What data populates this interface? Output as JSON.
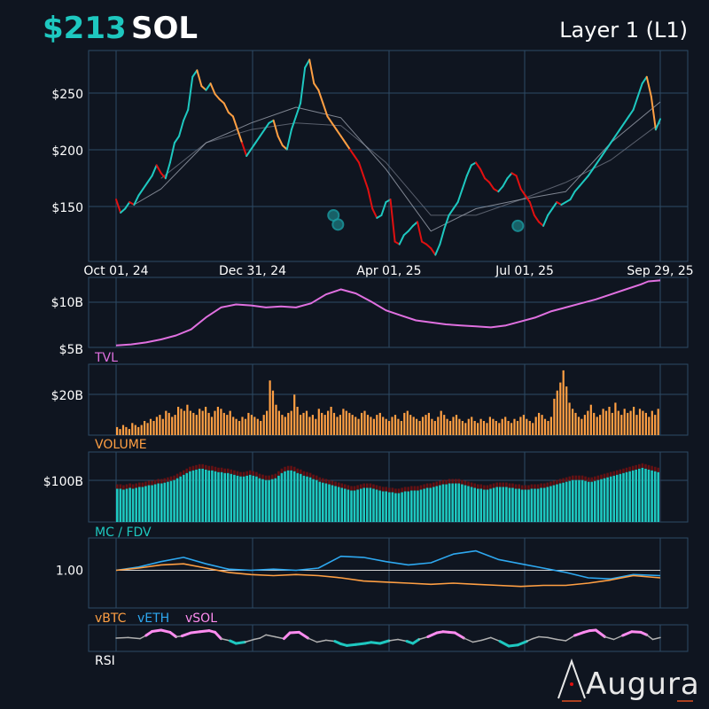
{
  "header": {
    "price": "$213",
    "symbol": "SOL",
    "category": "Layer 1 (L1)"
  },
  "brand": {
    "name": "Augura"
  },
  "colors": {
    "up": "#1ec8c0",
    "mid": "#ff9f43",
    "down": "#e01010",
    "tvl": "#e070e0",
    "volume": "#ff9f43",
    "mc": "#1ec8c0",
    "vbtc": "#ff9f43",
    "veth": "#2ea8f0",
    "vsol": "#ff8cf0",
    "grid": "#2d4a66"
  },
  "chart_data": [
    {
      "id": "price",
      "type": "line",
      "x_ticks": [
        "Oct 01, 24",
        "Dec 31, 24",
        "Apr 01, 25",
        "Jul 01, 25",
        "Sep 29, 25"
      ],
      "y_ticks": [
        "$250",
        "$200",
        "$150"
      ],
      "ylim": [
        105,
        265
      ],
      "series": [
        {
          "role": "price",
          "x": [
            0,
            3,
            6,
            9,
            12,
            15,
            18,
            21,
            24,
            27,
            30,
            33,
            36,
            39,
            42,
            45,
            48,
            51,
            54,
            57,
            60,
            63,
            66,
            69,
            72,
            75,
            78,
            81,
            84,
            87,
            90,
            93,
            96,
            99,
            102,
            105,
            108,
            111,
            114,
            117,
            120,
            123,
            126,
            129,
            132,
            135,
            138,
            141,
            144,
            147,
            150,
            153,
            156,
            159,
            162,
            165,
            168,
            171,
            174,
            177,
            180,
            183,
            186,
            189,
            192,
            195,
            198,
            201,
            204,
            207,
            210,
            213,
            216,
            219,
            222,
            225,
            228,
            231,
            234,
            237,
            240,
            243,
            246,
            249,
            252,
            255,
            258,
            261,
            264,
            267,
            270,
            273,
            276,
            279,
            282,
            285,
            288,
            291,
            294,
            297,
            300,
            303,
            306,
            309,
            312,
            315,
            318,
            321,
            324,
            327,
            330,
            333,
            336,
            339,
            342,
            345,
            348,
            351,
            354,
            357,
            360,
            363
          ],
          "values": [
            152,
            142,
            145,
            150,
            148,
            155,
            160,
            165,
            170,
            178,
            172,
            168,
            180,
            195,
            200,
            212,
            220,
            245,
            250,
            238,
            235,
            240,
            232,
            228,
            225,
            218,
            215,
            205,
            195,
            185,
            190,
            195,
            200,
            205,
            210,
            212,
            200,
            193,
            190,
            205,
            215,
            225,
            252,
            258,
            240,
            235,
            225,
            215,
            210,
            205,
            200,
            195,
            190,
            185,
            180,
            170,
            160,
            145,
            138,
            140,
            150,
            152,
            120,
            118,
            125,
            128,
            132,
            135,
            120,
            118,
            115,
            110,
            118,
            130,
            140,
            145,
            150,
            160,
            170,
            178,
            180,
            175,
            168,
            165,
            160,
            158,
            162,
            168,
            172,
            170,
            160,
            155,
            150,
            140,
            135,
            132,
            140,
            145,
            150,
            148,
            150,
            152,
            158,
            162,
            166,
            170,
            175,
            180,
            185,
            190,
            195,
            200,
            205,
            210,
            215,
            220,
            230,
            240,
            245,
            230,
            205,
            213
          ]
        },
        {
          "role": "ma_short",
          "x": [
            12,
            30,
            60,
            90,
            120,
            150,
            180,
            210,
            240,
            270,
            300,
            330,
            363
          ],
          "values": [
            148,
            160,
            195,
            210,
            222,
            214,
            175,
            128,
            145,
            152,
            158,
            195,
            226
          ]
        },
        {
          "role": "ma_long",
          "x": [
            30,
            60,
            90,
            120,
            150,
            180,
            210,
            240,
            270,
            300,
            330,
            363
          ],
          "values": [
            168,
            195,
            205,
            210,
            208,
            180,
            140,
            140,
            152,
            165,
            182,
            210
          ]
        }
      ],
      "markers": [
        {
          "x": 145,
          "y": 140
        },
        {
          "x": 148,
          "y": 133
        },
        {
          "x": 268,
          "y": 132
        }
      ]
    },
    {
      "id": "tvl",
      "type": "line",
      "label": "TVL",
      "y_ticks": [
        "$10B",
        "$5B"
      ],
      "ylim": [
        5,
        12
      ],
      "series": [
        {
          "name": "TVL",
          "x": [
            0,
            10,
            20,
            30,
            40,
            50,
            60,
            70,
            80,
            90,
            100,
            110,
            120,
            130,
            140,
            150,
            160,
            170,
            180,
            190,
            200,
            210,
            220,
            230,
            240,
            250,
            260,
            270,
            280,
            290,
            300,
            310,
            320,
            330,
            340,
            350,
            355,
            363
          ],
          "values": [
            5.2,
            5.3,
            5.5,
            5.8,
            6.2,
            6.8,
            8.0,
            9.0,
            9.3,
            9.2,
            9.0,
            9.1,
            9.0,
            9.4,
            10.3,
            10.8,
            10.4,
            9.6,
            8.7,
            8.2,
            7.7,
            7.5,
            7.3,
            7.2,
            7.1,
            7.0,
            7.2,
            7.6,
            8.0,
            8.6,
            9.0,
            9.4,
            9.8,
            10.3,
            10.8,
            11.3,
            11.6,
            11.7
          ]
        }
      ]
    },
    {
      "id": "volume",
      "type": "bar",
      "label": "VOLUME",
      "y_ticks": [
        "$20B"
      ],
      "ylim": [
        0,
        35
      ],
      "series": [
        {
          "name": "VOLUME",
          "values": [
            4,
            3,
            5,
            4,
            3,
            6,
            5,
            4,
            5,
            7,
            6,
            8,
            7,
            9,
            10,
            8,
            12,
            11,
            9,
            10,
            14,
            13,
            12,
            15,
            12,
            11,
            10,
            13,
            12,
            14,
            11,
            9,
            12,
            14,
            13,
            11,
            10,
            12,
            9,
            8,
            7,
            9,
            8,
            11,
            10,
            9,
            8,
            7,
            10,
            12,
            27,
            22,
            15,
            12,
            10,
            9,
            11,
            12,
            20,
            14,
            10,
            11,
            12,
            9,
            10,
            8,
            13,
            11,
            10,
            12,
            14,
            11,
            9,
            10,
            13,
            12,
            11,
            10,
            9,
            8,
            11,
            12,
            10,
            9,
            8,
            10,
            11,
            9,
            8,
            7,
            9,
            10,
            8,
            7,
            11,
            12,
            10,
            9,
            8,
            7,
            9,
            10,
            11,
            8,
            7,
            9,
            12,
            10,
            8,
            7,
            9,
            10,
            8,
            7,
            6,
            8,
            9,
            7,
            6,
            8,
            7,
            6,
            9,
            8,
            7,
            6,
            8,
            9,
            7,
            6,
            8,
            7,
            9,
            10,
            8,
            7,
            6,
            9,
            11,
            10,
            8,
            7,
            9,
            18,
            22,
            26,
            32,
            24,
            16,
            13,
            11,
            9,
            8,
            10,
            12,
            15,
            11,
            9,
            10,
            13,
            12,
            14,
            11,
            16,
            12,
            10,
            13,
            11,
            12,
            14,
            10,
            13,
            12,
            11,
            9,
            12,
            10,
            13
          ]
        }
      ]
    },
    {
      "id": "mcfdv",
      "type": "bar",
      "label": "MC / FDV",
      "y_ticks": [
        "$100B"
      ],
      "ylim": [
        60,
        140
      ],
      "series": [
        {
          "name": "MC",
          "values": [
            98,
            98,
            97,
            98,
            99,
            98,
            99,
            100,
            100,
            101,
            102,
            102,
            103,
            104,
            104,
            105,
            106,
            107,
            108,
            110,
            112,
            114,
            116,
            118,
            119,
            120,
            121,
            121,
            120,
            119,
            119,
            118,
            117,
            117,
            116,
            116,
            115,
            114,
            113,
            112,
            112,
            113,
            114,
            113,
            112,
            110,
            109,
            108,
            108,
            109,
            110,
            113,
            116,
            118,
            119,
            119,
            118,
            116,
            115,
            113,
            112,
            111,
            109,
            108,
            106,
            105,
            104,
            103,
            102,
            101,
            100,
            99,
            98,
            97,
            96,
            96,
            97,
            98,
            99,
            99,
            99,
            98,
            97,
            96,
            95,
            95,
            94,
            94,
            93,
            93,
            94,
            95,
            95,
            96,
            96,
            96,
            97,
            98,
            99,
            99,
            100,
            101,
            102,
            103,
            103,
            104,
            104,
            104,
            104,
            103,
            102,
            101,
            100,
            99,
            98,
            98,
            97,
            97,
            98,
            99,
            100,
            100,
            100,
            100,
            99,
            99,
            98,
            98,
            97,
            97,
            97,
            98,
            98,
            98,
            99,
            99,
            100,
            101,
            102,
            103,
            104,
            105,
            106,
            107,
            108,
            108,
            108,
            108,
            107,
            106,
            106,
            107,
            108,
            109,
            110,
            111,
            112,
            113,
            114,
            115,
            116,
            117,
            118,
            119,
            120,
            121,
            122,
            121,
            120,
            119,
            118,
            117
          ]
        }
      ]
    },
    {
      "id": "relative",
      "type": "line",
      "label": "vBTC vETH vSOL",
      "y_ticks": [
        "1.00"
      ],
      "ylim": [
        0.65,
        1.3
      ],
      "series": [
        {
          "name": "vBTC",
          "x": [
            0,
            15,
            30,
            45,
            60,
            75,
            90,
            105,
            120,
            135,
            150,
            165,
            180,
            195,
            210,
            225,
            240,
            255,
            270,
            285,
            300,
            315,
            330,
            345,
            363
          ],
          "values": [
            1.0,
            1.02,
            1.05,
            1.06,
            1.02,
            0.98,
            0.96,
            0.95,
            0.96,
            0.95,
            0.93,
            0.9,
            0.89,
            0.88,
            0.87,
            0.88,
            0.87,
            0.86,
            0.85,
            0.86,
            0.86,
            0.88,
            0.91,
            0.95,
            0.93
          ]
        },
        {
          "name": "vETH",
          "x": [
            0,
            15,
            30,
            45,
            60,
            75,
            90,
            105,
            120,
            135,
            150,
            165,
            180,
            195,
            210,
            225,
            240,
            255,
            270,
            285,
            300,
            315,
            330,
            345,
            363
          ],
          "values": [
            1.0,
            1.03,
            1.08,
            1.12,
            1.06,
            1.01,
            1.0,
            1.01,
            1.0,
            1.02,
            1.13,
            1.12,
            1.08,
            1.05,
            1.07,
            1.15,
            1.18,
            1.1,
            1.06,
            1.02,
            0.98,
            0.93,
            0.92,
            0.96,
            0.95
          ]
        }
      ]
    },
    {
      "id": "rsi",
      "type": "line",
      "label": "RSI",
      "ylim": [
        0,
        100
      ],
      "series": [
        {
          "name": "RSI",
          "x": [
            0,
            8,
            16,
            20,
            24,
            30,
            36,
            40,
            44,
            50,
            56,
            62,
            66,
            70,
            76,
            80,
            86,
            92,
            96,
            100,
            106,
            112,
            116,
            122,
            128,
            134,
            140,
            146,
            150,
            154,
            160,
            166,
            170,
            176,
            182,
            188,
            194,
            198,
            202,
            208,
            214,
            218,
            222,
            226,
            232,
            238,
            244,
            250,
            256,
            262,
            268,
            274,
            278,
            282,
            288,
            294,
            300,
            306,
            312,
            316,
            320,
            326,
            332,
            338,
            344,
            350,
            354,
            358,
            363
          ],
          "values": [
            50,
            52,
            48,
            60,
            75,
            80,
            72,
            55,
            58,
            70,
            74,
            78,
            72,
            48,
            40,
            30,
            35,
            45,
            50,
            62,
            55,
            48,
            70,
            72,
            50,
            35,
            42,
            38,
            28,
            22,
            26,
            30,
            34,
            30,
            40,
            45,
            38,
            30,
            45,
            55,
            70,
            74,
            72,
            70,
            50,
            35,
            42,
            52,
            38,
            20,
            24,
            38,
            48,
            55,
            52,
            45,
            40,
            60,
            72,
            78,
            80,
            55,
            45,
            60,
            74,
            72,
            62,
            45,
            52
          ]
        }
      ]
    }
  ]
}
